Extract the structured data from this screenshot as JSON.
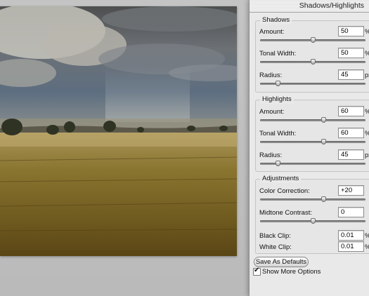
{
  "dialog": {
    "title": "Shadows/Highlights"
  },
  "shadows": {
    "title": "Shadows",
    "amount": {
      "label": "Amount:",
      "value": "50",
      "unit": "%",
      "level": 0.5
    },
    "tonal_width": {
      "label": "Tonal Width:",
      "value": "50",
      "unit": "%",
      "level": 0.5
    },
    "radius": {
      "label": "Radius:",
      "value": "45",
      "unit": "px",
      "level": 0.17
    }
  },
  "highlights": {
    "title": "Highlights",
    "amount": {
      "label": "Amount:",
      "value": "60",
      "unit": "%",
      "level": 0.6
    },
    "tonal_width": {
      "label": "Tonal Width:",
      "value": "60",
      "unit": "%",
      "level": 0.6
    },
    "radius": {
      "label": "Radius:",
      "value": "45",
      "unit": "px",
      "level": 0.17
    }
  },
  "adjustments": {
    "title": "Adjustments",
    "color_correction": {
      "label": "Color Correction:",
      "value": "+20",
      "level": 0.6
    },
    "midtone_contrast": {
      "label": "Midtone Contrast:",
      "value": "0",
      "level": 0.5
    },
    "black_clip": {
      "label": "Black Clip:",
      "value": "0.01",
      "unit": "%"
    },
    "white_clip": {
      "label": "White Clip:",
      "value": "0.01",
      "unit": "%"
    }
  },
  "footer": {
    "save_defaults_label": "Save As Defaults",
    "show_more_options_label": "Show More Options",
    "show_more_options_checked": true,
    "check_glyph": "✔"
  }
}
